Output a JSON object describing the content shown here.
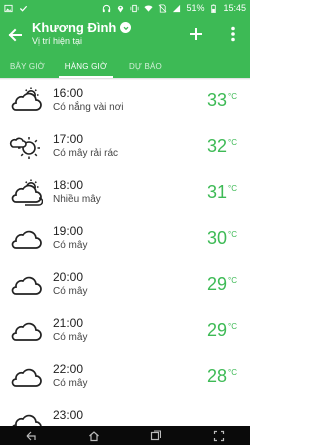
{
  "status_bar": {
    "battery": "51%",
    "time": "15:45"
  },
  "app_bar": {
    "location_title": "Khương Đình",
    "location_subtitle": "Vị trí hiện tại"
  },
  "tabs": [
    {
      "label": "BÂY GIỜ",
      "active": false
    },
    {
      "label": "HÀNG GIỜ",
      "active": true
    },
    {
      "label": "DỰ BÁO",
      "active": false
    }
  ],
  "temperature_unit": "°C",
  "accent_color": "#3dba55",
  "hours": [
    {
      "time": "16:00",
      "desc": "Có nắng vài nơi",
      "temp": "33",
      "icon": "partly-sunny-icon"
    },
    {
      "time": "17:00",
      "desc": "Có mây rải rác",
      "temp": "32",
      "icon": "sun-behind-cloud-icon"
    },
    {
      "time": "18:00",
      "desc": "Nhiều mây",
      "temp": "31",
      "icon": "mostly-cloudy-icon"
    },
    {
      "time": "19:00",
      "desc": "Có mây",
      "temp": "30",
      "icon": "cloudy-icon"
    },
    {
      "time": "20:00",
      "desc": "Có mây",
      "temp": "29",
      "icon": "cloudy-icon"
    },
    {
      "time": "21:00",
      "desc": "Có mây",
      "temp": "29",
      "icon": "cloudy-icon"
    },
    {
      "time": "22:00",
      "desc": "Có mây",
      "temp": "28",
      "icon": "cloudy-icon"
    },
    {
      "time": "23:00",
      "desc": "",
      "temp": "",
      "icon": "cloudy-icon"
    }
  ]
}
